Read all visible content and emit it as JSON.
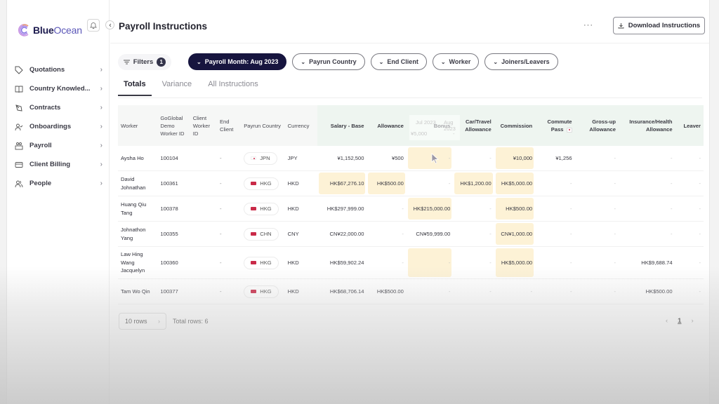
{
  "app": {
    "logo_bold": "Blue",
    "logo_light": "Ocean",
    "brand_color": "#17153f",
    "highlight_color": "#fdf2d6",
    "header_green": "#eef5f0"
  },
  "sidebar": {
    "items": [
      {
        "label": "Quotations",
        "icon": "tag-icon"
      },
      {
        "label": "Country Knowled...",
        "icon": "book-icon"
      },
      {
        "label": "Contracts",
        "icon": "contract-pen-icon"
      },
      {
        "label": "Onboardings",
        "icon": "user-check-icon"
      },
      {
        "label": "Payroll",
        "icon": "payroll-icon"
      },
      {
        "label": "Client Billing",
        "icon": "credit-card-icon"
      },
      {
        "label": "People",
        "icon": "people-icon"
      }
    ]
  },
  "header": {
    "title": "Payroll Instructions",
    "more": "···",
    "download_label": "Download Instructions"
  },
  "filters": {
    "label": "Filters",
    "count": "1",
    "chips": [
      {
        "label": "Payroll Month: Aug 2023",
        "active": true
      },
      {
        "label": "Payrun Country"
      },
      {
        "label": "End Client"
      },
      {
        "label": "Worker"
      },
      {
        "label": "Joiners/Leavers"
      }
    ]
  },
  "tabs": [
    {
      "label": "Totals",
      "active": true
    },
    {
      "label": "Variance"
    },
    {
      "label": "All Instructions"
    }
  ],
  "table": {
    "columns": [
      "Worker",
      "GoGlobal Demo Worker ID",
      "Client Worker ID",
      "End Client",
      "Payrun Country",
      "Currency",
      "Salary - Base",
      "Allowance",
      "Bonus",
      "Car/Travel Allowance",
      "Commission",
      "Commute Pass",
      "Gross-up Allowance",
      "Insurance/Health Allowance",
      "Leaver"
    ],
    "rows": [
      {
        "worker": "Aysha Ho",
        "id": "100104",
        "client_id": "",
        "end_client": "-",
        "country": "JPN",
        "currency": "JPY",
        "salary": "¥1,152,500",
        "allowance": "¥500",
        "bonus": "-",
        "car": "-",
        "commission": "¥10,000",
        "commute": "¥1,256",
        "grossup": "-",
        "insurance": "-",
        "leaver": "-"
      },
      {
        "worker": "David Johnathan",
        "id": "100361",
        "client_id": "",
        "end_client": "-",
        "country": "HKG",
        "currency": "HKD",
        "salary": "HK$67,276.10",
        "allowance": "HK$500.00",
        "bonus": "-",
        "car": "HK$1,200.00",
        "commission": "HK$5,000.00",
        "commute": "-",
        "grossup": "-",
        "insurance": "-",
        "leaver": "-"
      },
      {
        "worker": "Huang Qiu Tang",
        "id": "100378",
        "client_id": "",
        "end_client": "-",
        "country": "HKG",
        "currency": "HKD",
        "salary": "HK$297,999.00",
        "allowance": "-",
        "bonus": "HK$215,000.00",
        "car": "-",
        "commission": "HK$500.00",
        "commute": "-",
        "grossup": "-",
        "insurance": "-",
        "leaver": "-"
      },
      {
        "worker": "Johnathon Yang",
        "id": "100355",
        "client_id": "",
        "end_client": "-",
        "country": "CHN",
        "currency": "CNY",
        "salary": "CN¥22,000.00",
        "allowance": "-",
        "bonus": "CN¥59,999.00",
        "car": "-",
        "commission": "CN¥1,000.00",
        "commute": "-",
        "grossup": "-",
        "insurance": "-",
        "leaver": "-"
      },
      {
        "worker": "Law Hing Wang Jacquelyn",
        "id": "100360",
        "client_id": "",
        "end_client": "-",
        "country": "HKG",
        "currency": "HKD",
        "salary": "HK$59,902.24",
        "allowance": "-",
        "bonus": "-",
        "car": "-",
        "commission": "HK$5,000.00",
        "commute": "-",
        "grossup": "-",
        "insurance": "HK$9,688.74",
        "leaver": "-"
      },
      {
        "worker": "Tam Wo Qin",
        "id": "100377",
        "client_id": "",
        "end_client": "-",
        "country": "HKG",
        "currency": "HKD",
        "salary": "HK$68,706.14",
        "allowance": "HK$500.00",
        "bonus": "-",
        "car": "-",
        "commission": "-",
        "commute": "-",
        "grossup": "-",
        "insurance": "HK$500.00",
        "leaver": "-"
      }
    ],
    "highlighted": {
      "0": [
        "bonus",
        "commission"
      ],
      "1": [
        "salary",
        "allowance",
        "car",
        "commission"
      ],
      "2": [
        "bonus",
        "commission"
      ],
      "3": [
        "commission"
      ],
      "4": [
        "bonus",
        "commission"
      ]
    }
  },
  "tooltip": {
    "prev_month": "Jul 2023",
    "curr_month": "Aug 2023",
    "prev_value": "¥5,000",
    "curr_value": "-"
  },
  "footer": {
    "rows_per_page": "10 rows",
    "total_rows": "Total rows: 6",
    "current_page": "1",
    "prev": "‹",
    "next": "›"
  }
}
